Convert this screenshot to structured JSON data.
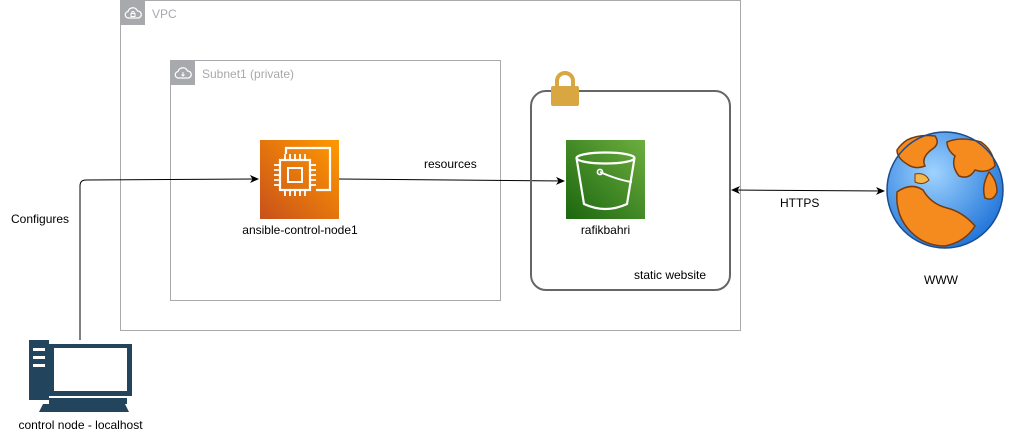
{
  "diagram": {
    "vpc": {
      "label": "VPC",
      "icon": "cloud-lock-icon"
    },
    "subnet": {
      "label": "Subnet1 (private)",
      "icon": "cloud-icon"
    },
    "ec2": {
      "label": "ansible-control-node1",
      "icon": "ec2-instance-icon",
      "color": "#ED7100"
    },
    "s3": {
      "label": "rafikbahri",
      "icon": "s3-bucket-icon",
      "color": "#3F8624"
    },
    "static_site": {
      "label": "static website",
      "icon": "padlock-icon",
      "lock_color": "#D9A741"
    },
    "www": {
      "label": "WWW",
      "icon": "globe-icon"
    },
    "control_node": {
      "label": "control node - localhost",
      "icon": "desktop-computer-icon",
      "color": "#23445D"
    },
    "edges": {
      "configures": "Configures",
      "resources": "resources",
      "https": "HTTPS"
    }
  }
}
